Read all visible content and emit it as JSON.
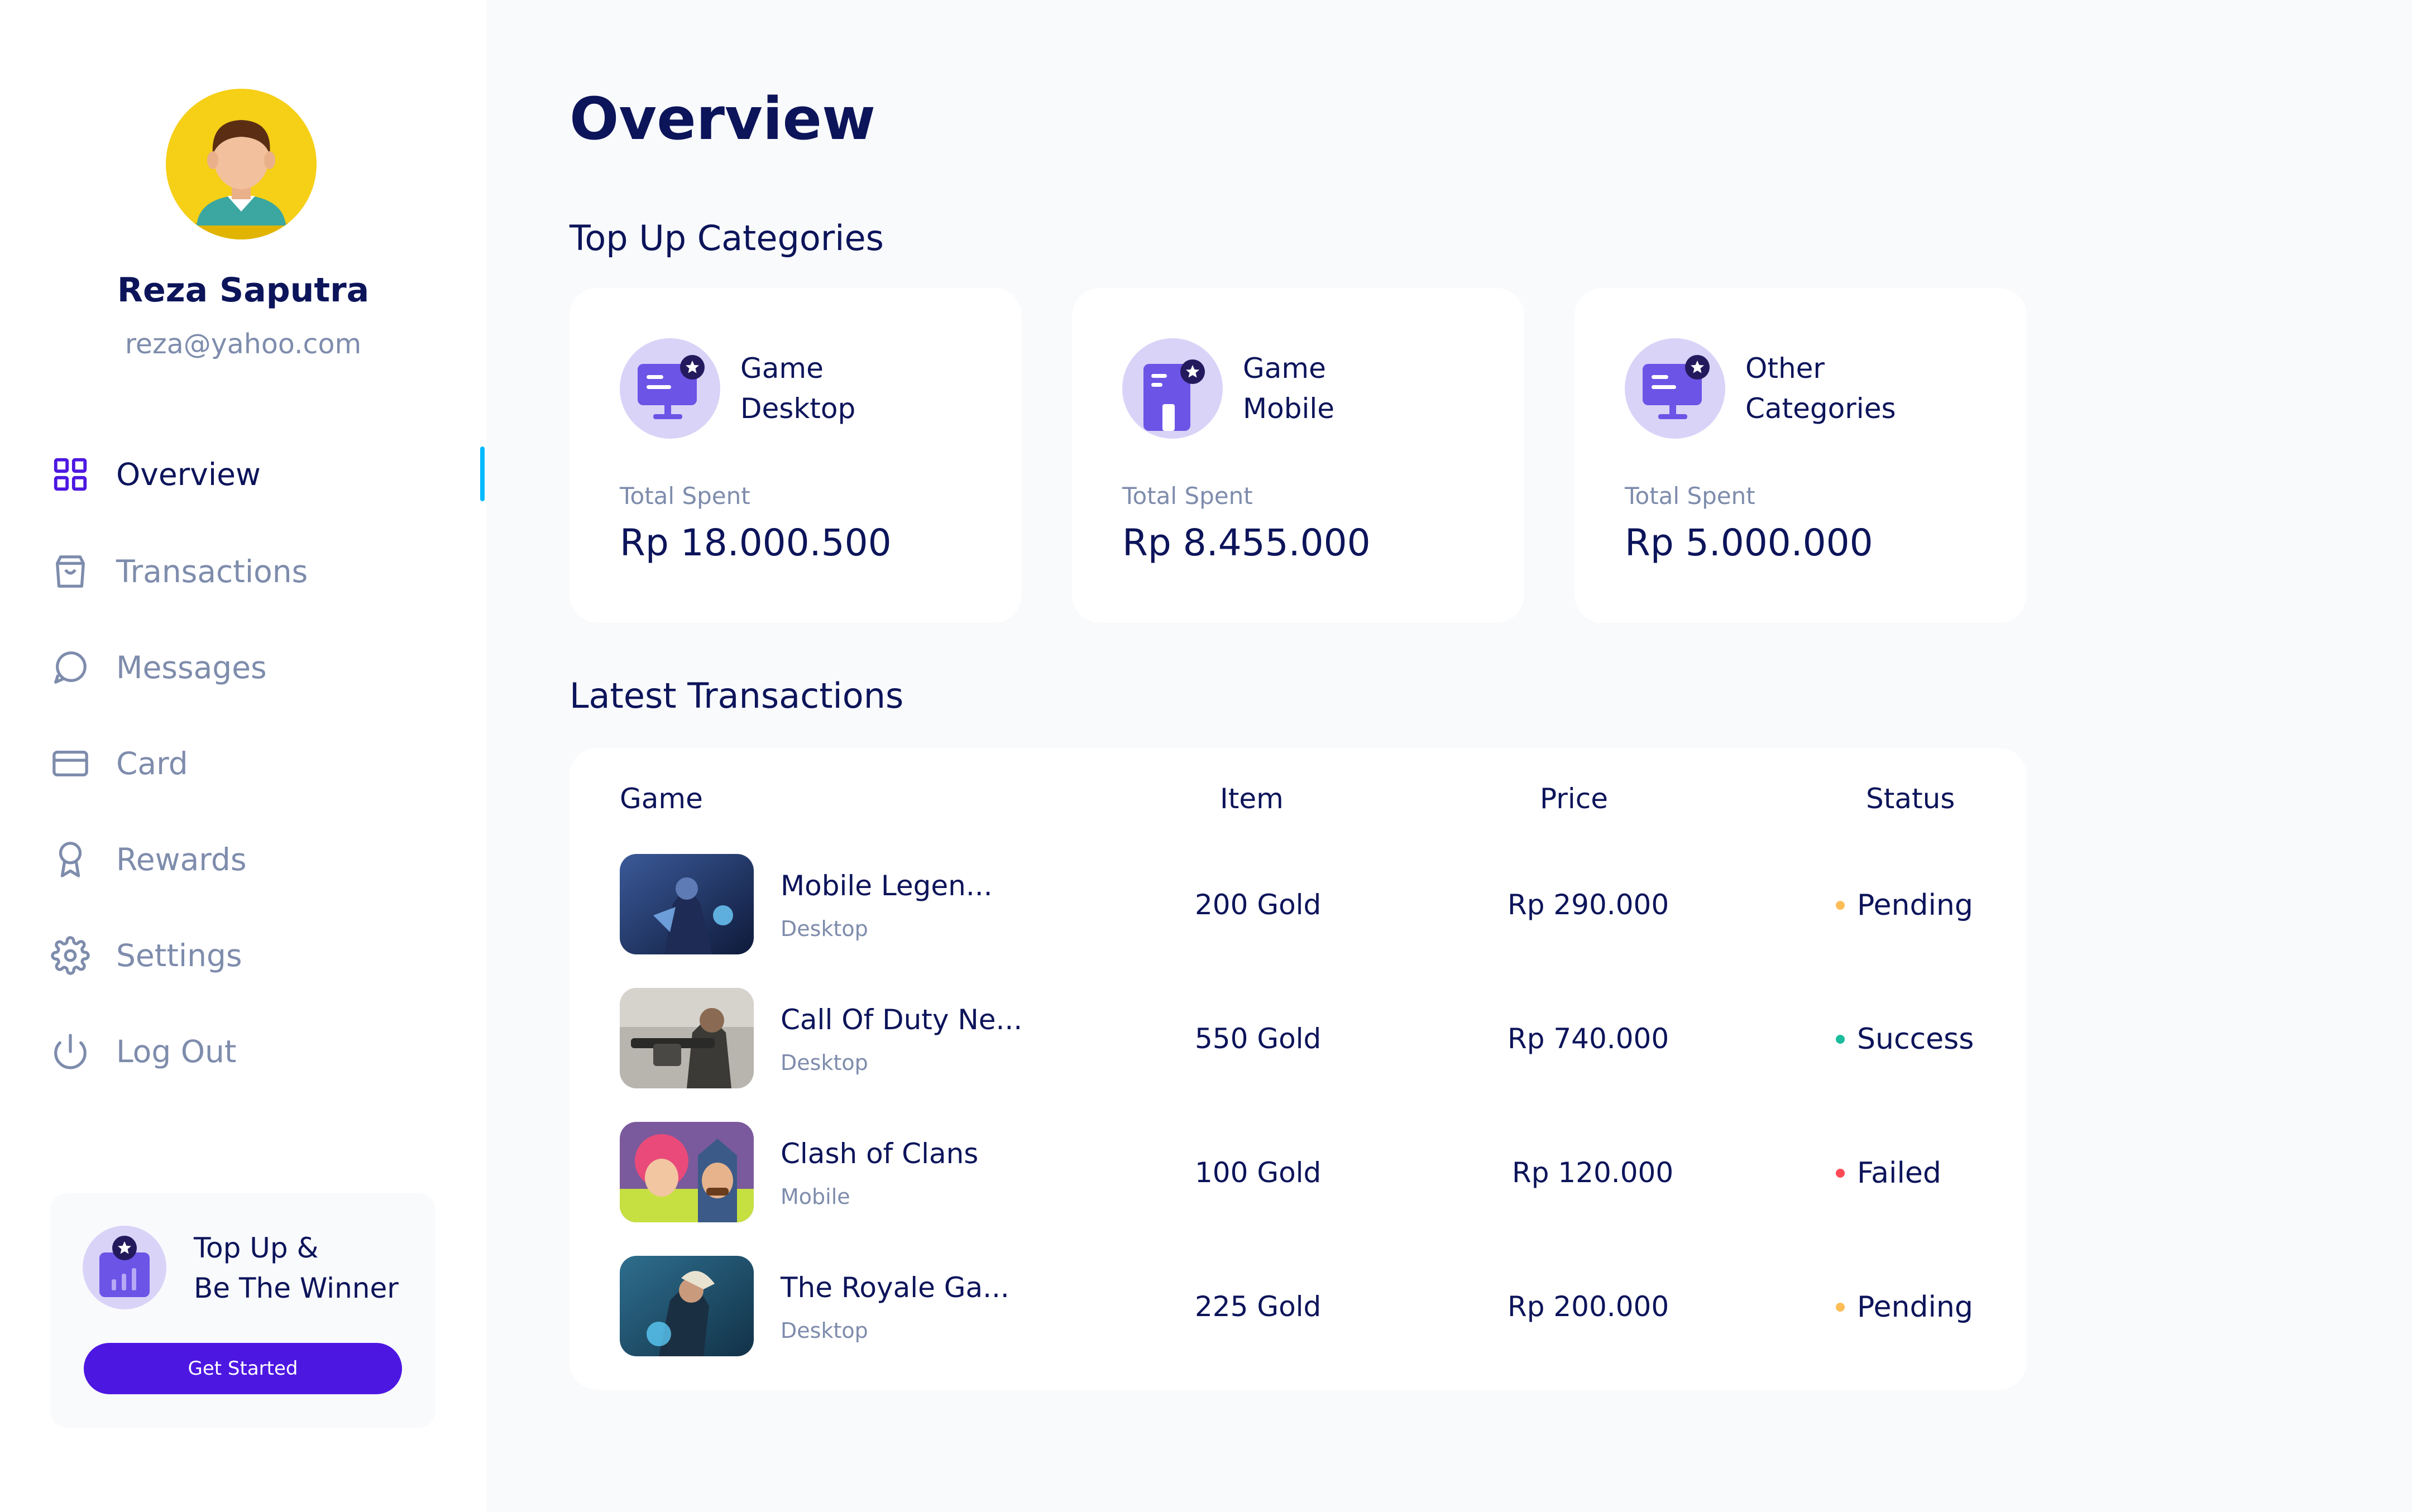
{
  "user": {
    "name": "Reza Saputra",
    "email": "reza@yahoo.com"
  },
  "nav": [
    {
      "label": "Overview",
      "icon": "grid-icon",
      "active": true
    },
    {
      "label": "Transactions",
      "icon": "shopping-bag-icon",
      "active": false
    },
    {
      "label": "Messages",
      "icon": "chat-bubble-icon",
      "active": false
    },
    {
      "label": "Card",
      "icon": "credit-card-icon",
      "active": false
    },
    {
      "label": "Rewards",
      "icon": "award-icon",
      "active": false
    },
    {
      "label": "Settings",
      "icon": "gear-icon",
      "active": false
    },
    {
      "label": "Log Out",
      "icon": "power-icon",
      "active": false
    }
  ],
  "promo": {
    "line1": "Top Up &",
    "line2": "Be The Winner",
    "button": "Get Started"
  },
  "page_title": "Overview",
  "categories_title": "Top Up Categories",
  "categories": [
    {
      "line1": "Game",
      "line2": "Desktop",
      "spent_label": "Total Spent",
      "spent": "Rp 18.000.500",
      "icon": "desktop-star-icon"
    },
    {
      "line1": "Game",
      "line2": "Mobile",
      "spent_label": "Total Spent",
      "spent": "Rp 8.455.000",
      "icon": "mobile-star-icon"
    },
    {
      "line1": "Other",
      "line2": "Categories",
      "spent_label": "Total Spent",
      "spent": "Rp 5.000.000",
      "icon": "desktop-star-icon"
    }
  ],
  "transactions_title": "Latest Transactions",
  "table": {
    "headers": {
      "game": "Game",
      "item": "Item",
      "price": "Price",
      "status": "Status"
    },
    "rows": [
      {
        "game": "Mobile Legen...",
        "platform": "Desktop",
        "item": "200 Gold",
        "price": "Rp 290.000",
        "status": "Pending",
        "status_color": "#FEBD57"
      },
      {
        "game": "Call Of Duty Ne...",
        "platform": "Desktop",
        "item": "550 Gold",
        "price": "Rp 740.000",
        "status": "Success",
        "status_color": "#1ABC9C"
      },
      {
        "game": "Clash of Clans",
        "platform": "Mobile",
        "item": "100 Gold",
        "price": "Rp 120.000",
        "status": "Failed",
        "status_color": "#FE4A55"
      },
      {
        "game": "The Royale Ga...",
        "platform": "Desktop",
        "item": "225 Gold",
        "price": "Rp 200.000",
        "status": "Pending",
        "status_color": "#FEBD57"
      }
    ]
  },
  "colors": {
    "primary": "#0C145A",
    "muted": "#7E8CAC",
    "accent": "#4D17E2",
    "active_indicator": "#00BAFF",
    "background": "#F9FAFC"
  }
}
